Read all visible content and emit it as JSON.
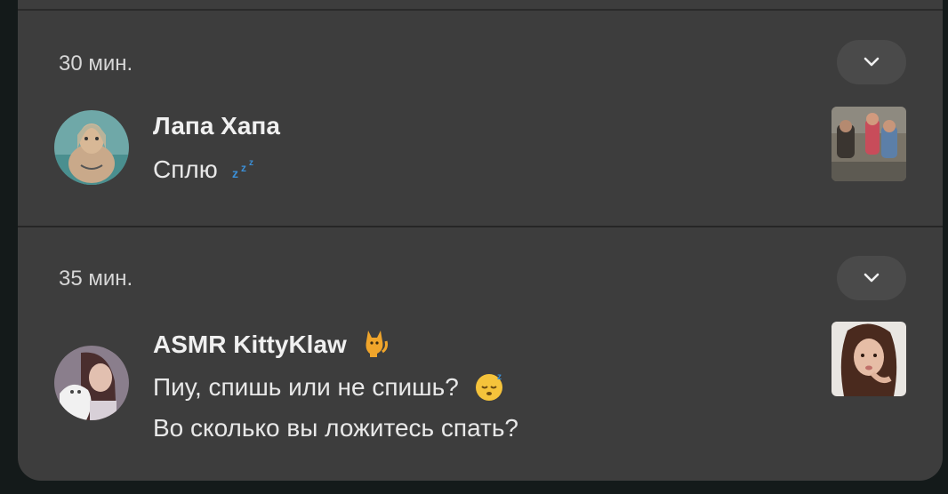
{
  "notifications": [
    {
      "time": "30 мин.",
      "sender": "Лапа Хапа",
      "message_lines": [
        "Сплю"
      ],
      "message_emoji": "zzz-emoji"
    },
    {
      "time": "35 мин.",
      "sender": "ASMR KittyKlaw",
      "sender_emoji": "cat-emoji",
      "message_lines": [
        "Пиу, спишь или не спишь?",
        "Во сколько вы ложитесь спать?"
      ],
      "message_emoji": "sleeping-face-emoji"
    }
  ],
  "icons": {
    "expand": "chevron-down-icon"
  },
  "colors": {
    "panel": "#3d3d3d",
    "button": "#4a4a4a",
    "background": "#141a1a",
    "text": "#e8e8e8",
    "zzz": "#3b8fd6",
    "emoji_yellow": "#f5c33b"
  }
}
